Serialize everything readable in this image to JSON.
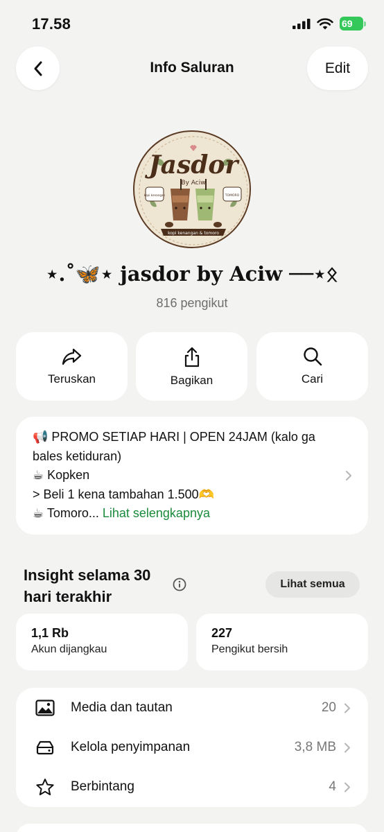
{
  "status_bar": {
    "time": "17.58",
    "battery": "69"
  },
  "nav": {
    "title": "Info Saluran",
    "edit_label": "Edit"
  },
  "avatar": {
    "logo_title": "Jasdor",
    "logo_sub": "By Aciw",
    "tag_left": "kopi kenangan",
    "tag_right": "TOMORO",
    "banner": "kopi kenangan & tomoro"
  },
  "channel": {
    "name": "⋆.˚🦋⋆ jasdor by Aciw ──⋆ᛟ",
    "followers": "816 pengikut"
  },
  "actions": [
    {
      "label": "Teruskan",
      "icon": "forward-icon"
    },
    {
      "label": "Bagikan",
      "icon": "share-icon"
    },
    {
      "label": "Cari",
      "icon": "search-icon"
    }
  ],
  "description": {
    "line1": "📢 PROMO SETIAP HARI | OPEN 24JAM (kalo ga bales ketiduran)",
    "line2": "☕ Kopken",
    "line3": "> Beli 1 kena tambahan 1.500🫶",
    "line4": "☕ Tomoro...",
    "more": "Lihat selengkapnya"
  },
  "insight": {
    "title": "Insight selama 30 hari terakhir",
    "see_all": "Lihat semua",
    "stats": [
      {
        "value": "1,1 Rb",
        "label": "Akun dijangkau"
      },
      {
        "value": "227",
        "label": "Pengikut bersih"
      }
    ]
  },
  "list": [
    {
      "label": "Media dan tautan",
      "value": "20",
      "icon": "photo-icon"
    },
    {
      "label": "Kelola penyimpanan",
      "value": "3,8 MB",
      "icon": "storage-icon"
    },
    {
      "label": "Berbintang",
      "value": "4",
      "icon": "star-icon"
    }
  ],
  "colors": {
    "accent_link": "#1a8a3c",
    "battery": "#34c759",
    "background": "#f3f3f2"
  }
}
